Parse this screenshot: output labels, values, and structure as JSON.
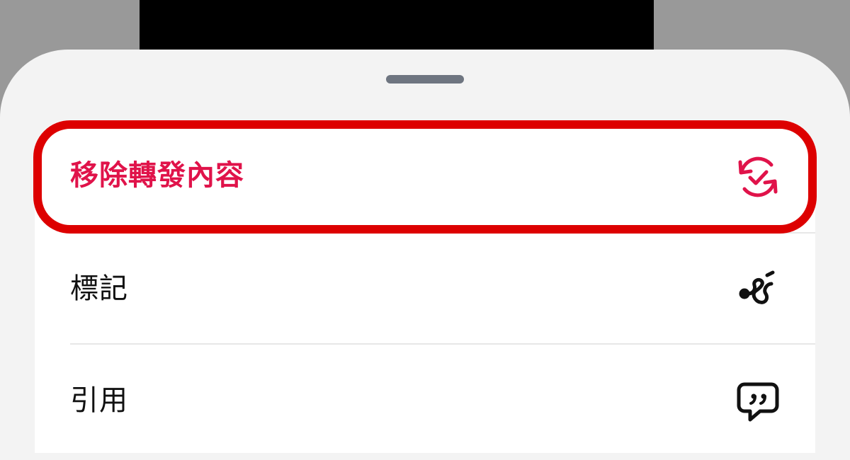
{
  "menu": {
    "items": [
      {
        "label": "移除轉發內容",
        "icon": "repost-remove-icon",
        "color": "#e0134a"
      },
      {
        "label": "標記",
        "icon": "squiggle-tag-icon",
        "color": "#111111"
      },
      {
        "label": "引用",
        "icon": "quote-bubble-icon",
        "color": "#111111"
      }
    ]
  },
  "colors": {
    "accent": "#e0134a",
    "highlight": "#dd0000",
    "sheet": "#f3f3f3",
    "backdrop": "#999999"
  }
}
